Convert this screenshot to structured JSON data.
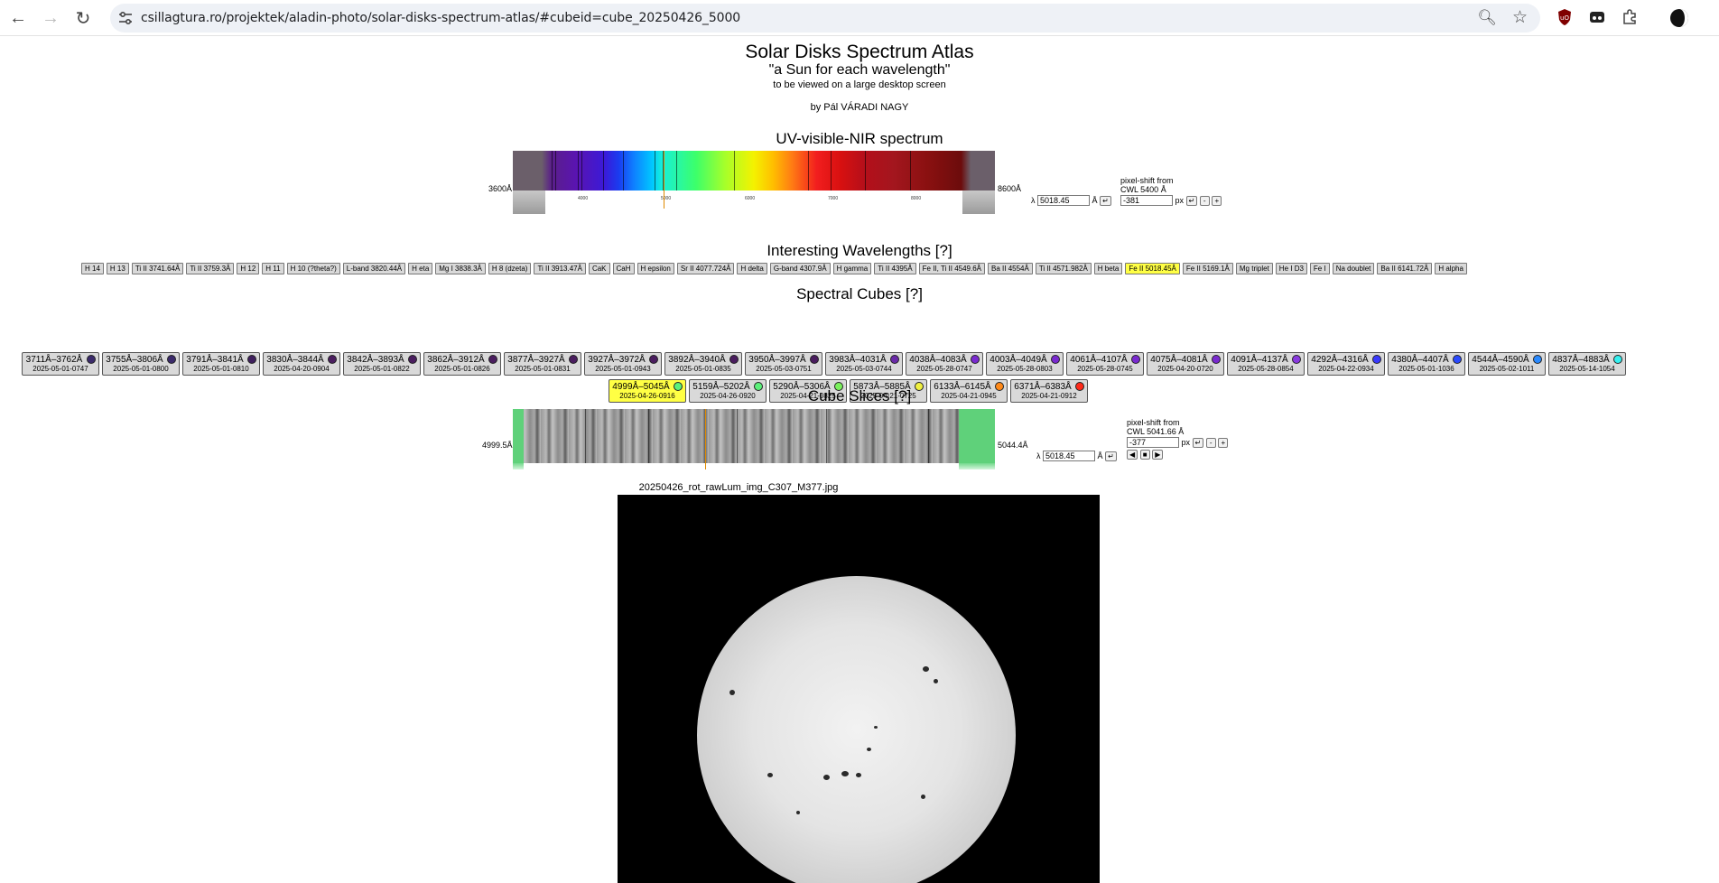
{
  "browser": {
    "url": "csillagtura.ro/projektek/aladin-photo/solar-disks-spectrum-atlas/#cubeid=cube_20250426_5000"
  },
  "header": {
    "title": "Solar Disks Spectrum Atlas",
    "tagline": "\"a Sun for each wavelength\"",
    "note": "to be viewed on a large desktop screen",
    "author": "by Pál VÁRADI NAGY"
  },
  "spectrum": {
    "heading": "UV-visible-NIR spectrum",
    "left_label": "3600Å",
    "right_label": "8600Å",
    "ticks": [
      "4000",
      "5000",
      "6000",
      "7000",
      "8000"
    ],
    "lambda_symbol": "λ",
    "lambda_value": "5018.45",
    "unit": "Å",
    "enter_label": "↵",
    "shift_title": "pixel-shift from",
    "shift_cwl": "CWL 5400 Å",
    "shift_value": "-381",
    "px_label": "px",
    "minus_label": "-",
    "plus_label": "+"
  },
  "wavelengths": {
    "heading": "Interesting Wavelengths [?]",
    "items": [
      "H 14",
      "H 13",
      "Ti II 3741.64Å",
      "Ti II 3759.3Å",
      "H 12",
      "H 11",
      "H 10 (?theta?)",
      "L-band 3820.44Å",
      "H eta",
      "Mg I 3838.3Å",
      "H 8 (dzeta)",
      "Ti II 3913.47Å",
      "CaK",
      "CaH",
      "H epsilon",
      "Sr II 4077.724Å",
      "H delta",
      "G-band 4307.9Å",
      "H gamma",
      "Ti II 4395Å",
      "Fe II, Ti II 4549.6Å",
      "Ba II 4554Å",
      "Ti II 4571.982Å",
      "H beta",
      "Fe II 5018.45Å",
      "Fe II 5169.1Å",
      "Mg triplet",
      "He I D3",
      "Fe I",
      "Na doublet",
      "Ba II 6141.72Å",
      "H alpha"
    ],
    "active": "Fe II 5018.45Å"
  },
  "cubes": {
    "heading": "Spectral Cubes [?]",
    "row1": [
      {
        "range": "3711Å–3762Å",
        "date": "2025-05-01-0747",
        "color": "#3b2a6b"
      },
      {
        "range": "3755Å–3806Å",
        "date": "2025-05-01-0800",
        "color": "#3b2a6b"
      },
      {
        "range": "3791Å–3841Å",
        "date": "2025-05-01-0810",
        "color": "#3f1f5e"
      },
      {
        "range": "3830Å–3844Å",
        "date": "2025-04-20-0904",
        "color": "#4a1d5f"
      },
      {
        "range": "3842Å–3893Å",
        "date": "2025-05-01-0822",
        "color": "#4a1d5f"
      },
      {
        "range": "3862Å–3912Å",
        "date": "2025-05-01-0826",
        "color": "#4a1d5f"
      },
      {
        "range": "3877Å–3927Å",
        "date": "2025-05-01-0831",
        "color": "#4a1d5f"
      },
      {
        "range": "3927Å–3972Å",
        "date": "2025-05-01-0943",
        "color": "#4a1d5f"
      },
      {
        "range": "3892Å–3940Å",
        "date": "2025-05-01-0835",
        "color": "#4a1d5f"
      },
      {
        "range": "3950Å–3997Å",
        "date": "2025-05-03-0751",
        "color": "#4a1d5f"
      },
      {
        "range": "3983Å–4031Å",
        "date": "2025-05-03-0744",
        "color": "#6a2aa8"
      },
      {
        "range": "4038Å–4083Å",
        "date": "2025-05-28-0747",
        "color": "#7a2ad0"
      },
      {
        "range": "4003Å–4049Å",
        "date": "2025-05-28-0803",
        "color": "#7a2ad0"
      },
      {
        "range": "4061Å–4107Å",
        "date": "2025-05-28-0745",
        "color": "#7a2ad0"
      },
      {
        "range": "4075Å–4081Å",
        "date": "2025-04-20-0720",
        "color": "#7a2ad0"
      },
      {
        "range": "4091Å–4137Å",
        "date": "2025-05-28-0854",
        "color": "#8a3ae0"
      },
      {
        "range": "4292Å–4316Å",
        "date": "2025-04-22-0934",
        "color": "#3a3aff"
      },
      {
        "range": "4380Å–4407Å",
        "date": "2025-05-01-1036",
        "color": "#2a4aff"
      },
      {
        "range": "4544Å–4590Å",
        "date": "2025-05-02-1011",
        "color": "#2a8aff"
      },
      {
        "range": "4837Å–4883Å",
        "date": "2025-05-14-1054",
        "color": "#36f0f0"
      }
    ],
    "row2": [
      {
        "range": "4999Å–5045Å",
        "date": "2025-04-26-0916",
        "color": "#5cf07a",
        "active": true
      },
      {
        "range": "5159Å–5202Å",
        "date": "2025-04-26-0920",
        "color": "#5cf07a"
      },
      {
        "range": "5290Å–5306Å",
        "date": "2025-04-21-0825",
        "color": "#7af05c"
      },
      {
        "range": "5873Å–5885Å",
        "date": "2025-04-21-0725",
        "color": "#f0f040"
      },
      {
        "range": "6133Å–6145Å",
        "date": "2025-04-21-0945",
        "color": "#ff8a1a"
      },
      {
        "range": "6371Å–6383Å",
        "date": "2025-04-21-0912",
        "color": "#ff2a1a"
      }
    ]
  },
  "slices": {
    "heading": "Cube Slices [?]",
    "left_label": "4999.5Å",
    "right_label": "5044.4Å",
    "lambda_symbol": "λ",
    "lambda_value": "5018.45",
    "unit": "Å",
    "enter_label": "↵",
    "shift_title": "pixel-shift from",
    "shift_cwl": "CWL 5041.66 Å",
    "shift_value": "-377",
    "px_label": "px",
    "minus_label": "-",
    "plus_label": "+",
    "prev_label": "◀",
    "stop_label": "■",
    "play_label": "▶"
  },
  "image": {
    "filename": "20250426_rot_rawLum_img_C307_M377.jpg"
  }
}
